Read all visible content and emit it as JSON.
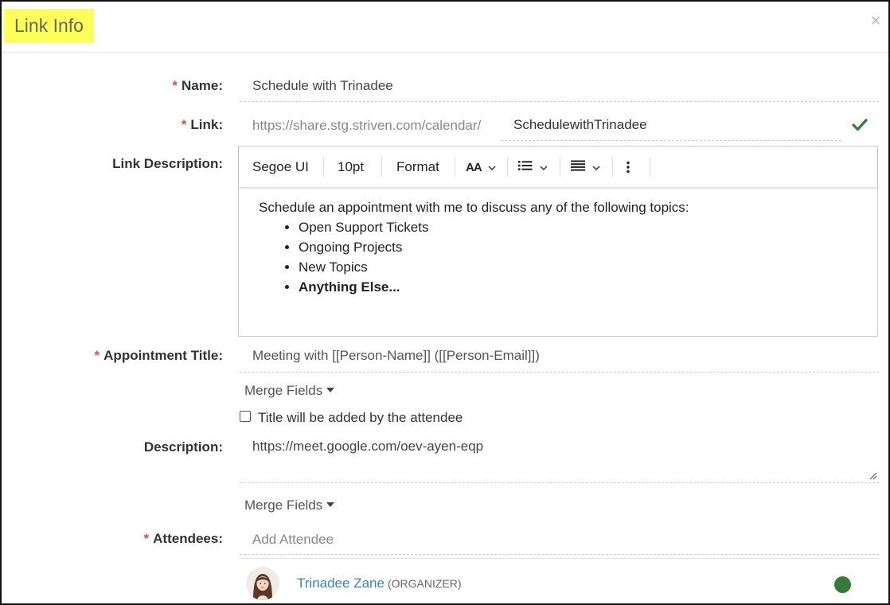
{
  "dialog": {
    "title": "Link Info",
    "close_icon": "×"
  },
  "form": {
    "required_marker": "*",
    "name": {
      "label": "Name:",
      "value": "Schedule with Trinadee"
    },
    "link": {
      "label": "Link:",
      "prefix": "https://share.stg.striven.com/calendar/",
      "value": "SchedulewithTrinadee",
      "status_icon": "check-icon"
    },
    "link_description": {
      "label": "Link Description:",
      "toolbar": {
        "font": "Segoe UI",
        "size": "10pt",
        "format": "Format",
        "text_style_icon": "AA",
        "list_icon": "list-icon",
        "align_icon": "align-icon",
        "more_icon": "more-vertical-icon"
      },
      "intro": "Schedule an appointment with me to discuss any of the following topics:",
      "bullets": [
        "Open Support Tickets",
        "Ongoing Projects",
        "New Topics"
      ],
      "bold_bullet": "Anything Else..."
    },
    "appointment_title": {
      "label": "Appointment Title:",
      "value": "Meeting with [[Person-Name]] ([[Person-Email]])"
    },
    "merge_fields_label": "Merge Fields",
    "title_checkbox": {
      "label": "Title will be added by the attendee",
      "checked": false
    },
    "description": {
      "label": "Description:",
      "value": "https://meet.google.com/oev-ayen-eqp"
    },
    "attendees": {
      "label": "Attendees:",
      "placeholder": "Add Attendee",
      "list": [
        {
          "name": "Trinadee Zane",
          "role": "(ORGANIZER)",
          "status_color": "#357a38"
        }
      ]
    }
  },
  "colors": {
    "title_highlight": "#ffff5a",
    "required": "#d9534f",
    "link": "#3a83c1",
    "success": "#357a38"
  }
}
